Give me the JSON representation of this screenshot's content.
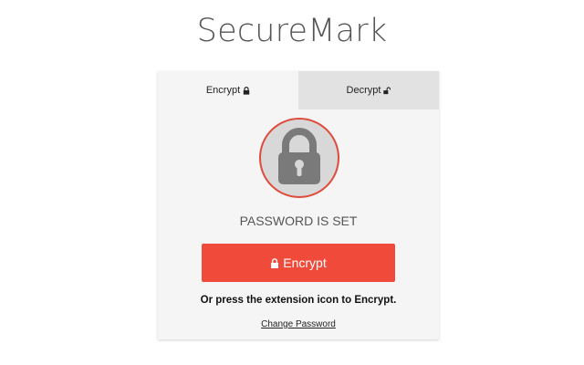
{
  "app": {
    "title": "SecureMark"
  },
  "tabs": [
    {
      "label": "Encrypt",
      "icon": "lock-icon",
      "active": true
    },
    {
      "label": "Decrypt",
      "icon": "unlock-icon",
      "active": false
    }
  ],
  "status": {
    "icon": "padlock-icon",
    "text": "PASSWORD IS SET"
  },
  "encrypt_button": {
    "label": "Encrypt",
    "icon": "lock-icon"
  },
  "hint": {
    "text": "Or press the extension icon to Encrypt."
  },
  "change_password": {
    "label": "Change Password"
  },
  "colors": {
    "accent": "#f04b3a",
    "circle_border": "#e04a3c",
    "padlock": "#7a7a7a",
    "circle_fill": "#d8d8d8"
  }
}
